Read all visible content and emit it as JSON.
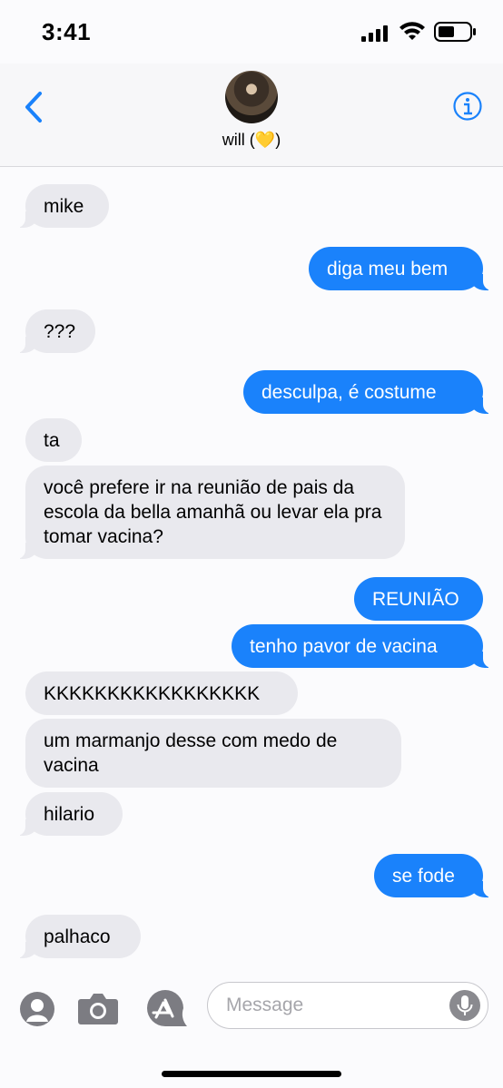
{
  "status_bar": {
    "time": "3:41",
    "battery_icon": "battery-icon",
    "wifi_icon": "wifi-icon",
    "signal_icon": "cellular-signal-icon"
  },
  "header": {
    "contact_name": "will (💛)",
    "back_icon": "chevron-left-icon",
    "info_icon": "info-icon"
  },
  "colors": {
    "outgoing": "#1a82fb",
    "incoming": "#e9e9ee",
    "accent": "#1a82fb"
  },
  "messages": [
    {
      "dir": "in",
      "text": "mike"
    },
    {
      "dir": "out",
      "text": "diga meu bem"
    },
    {
      "dir": "in",
      "text": "???"
    },
    {
      "dir": "out",
      "text": "desculpa, é costume"
    },
    {
      "dir": "in",
      "text": "ta"
    },
    {
      "dir": "in",
      "text": "você prefere ir na reunião de pais da escola da bella amanhã ou levar ela pra tomar vacina?"
    },
    {
      "dir": "out",
      "text": "REUNIÃO"
    },
    {
      "dir": "out",
      "text": "tenho pavor de vacina"
    },
    {
      "dir": "in",
      "text": "KKKKKKKKKKKKKKKKK"
    },
    {
      "dir": "in",
      "text": "um marmanjo desse com medo de vacina"
    },
    {
      "dir": "in",
      "text": "hilario"
    },
    {
      "dir": "out",
      "text": "se fode"
    },
    {
      "dir": "in",
      "text": "palhaco"
    }
  ],
  "composer": {
    "placeholder": "Message",
    "value": "",
    "icons": [
      "memoji-icon",
      "camera-icon",
      "app-store-icon",
      "microphone-icon"
    ]
  }
}
